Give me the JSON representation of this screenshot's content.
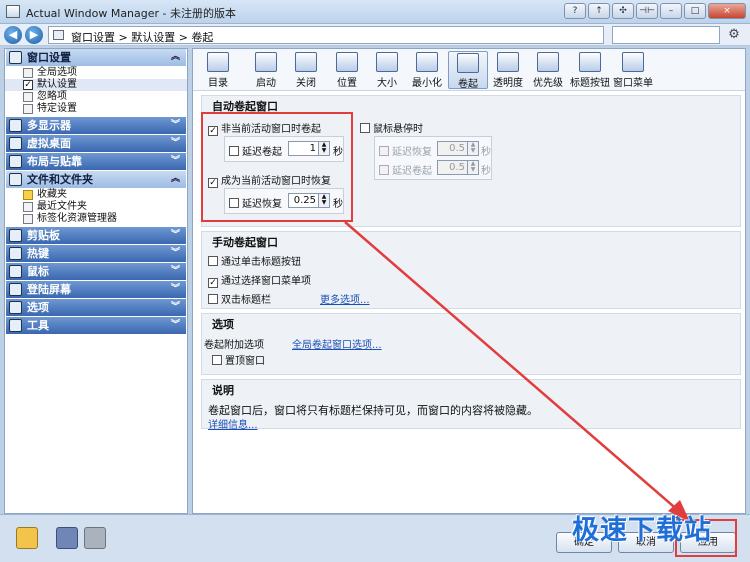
{
  "window": {
    "title": "Actual Window Manager - 未注册的版本",
    "buttons": [
      "?",
      "↑",
      "✣",
      "⊣⊢",
      "–",
      "□",
      "×"
    ]
  },
  "nav": {
    "back": "◀",
    "forward": "▶",
    "breadcrumb": "窗口设置 > 默认设置 > 卷起",
    "search_placeholder": ""
  },
  "sidebar": {
    "categories": [
      {
        "label": "窗口设置",
        "open": true,
        "items": [
          "全局选项",
          "默认设置",
          "忽略项",
          "特定设置"
        ]
      },
      {
        "label": "多显示器"
      },
      {
        "label": "虚拟桌面"
      },
      {
        "label": "布局与贴靠"
      },
      {
        "label": "文件和文件夹",
        "open": true,
        "items": [
          "收藏夹",
          "最近文件夹",
          "标签化资源管理器"
        ]
      },
      {
        "label": "剪贴板"
      },
      {
        "label": "热键"
      },
      {
        "label": "鼠标"
      },
      {
        "label": "登陆屏幕"
      },
      {
        "label": "选项"
      },
      {
        "label": "工具"
      }
    ]
  },
  "toolbar": {
    "items": [
      "目录",
      "启动",
      "关闭",
      "位置",
      "大小",
      "最小化",
      "卷起",
      "透明度",
      "优先级",
      "标题按钮",
      "窗口菜单"
    ],
    "active_index": 6
  },
  "auto_rollup": {
    "title": "自动卷起窗口",
    "on_inactive": {
      "label": "非当前活动窗口时卷起",
      "checked": true
    },
    "delay_rollup": {
      "label": "延迟卷起",
      "value": "1",
      "unit": "秒"
    },
    "on_active": {
      "label": "成为当前活动窗口时恢复",
      "checked": true
    },
    "delay_restore": {
      "label": "延迟恢复",
      "value": "0.25",
      "unit": "秒"
    },
    "hover": {
      "label": "鼠标悬停时",
      "checked": false
    },
    "hover_delay_restore": {
      "label": "延迟恢复",
      "value": "0.5",
      "unit": "秒"
    },
    "hover_delay_rollup": {
      "label": "延迟卷起",
      "value": "0.5",
      "unit": "秒"
    }
  },
  "manual_rollup": {
    "title": "手动卷起窗口",
    "click_title_button": "通过单击标题按钮",
    "window_menu": "通过选择窗口菜单项",
    "double_click": "双击标题栏",
    "more": "更多选项..."
  },
  "options": {
    "title": "选项",
    "extra": "卷起附加选项",
    "top": "置顶窗口",
    "global_link": "全局卷起窗口选项..."
  },
  "description": {
    "title": "说明",
    "text": "卷起窗口后，窗口将只有标题栏保持可见，而窗口的内容将被隐藏。",
    "more": "详细信息..."
  },
  "buttons": {
    "ok": "确定",
    "cancel": "取消",
    "apply": "应用"
  },
  "watermark": "极速下载站",
  "colors": {
    "accent": "#3a67b0",
    "highlight": "#e23d3d",
    "link": "#1a4fb5"
  }
}
